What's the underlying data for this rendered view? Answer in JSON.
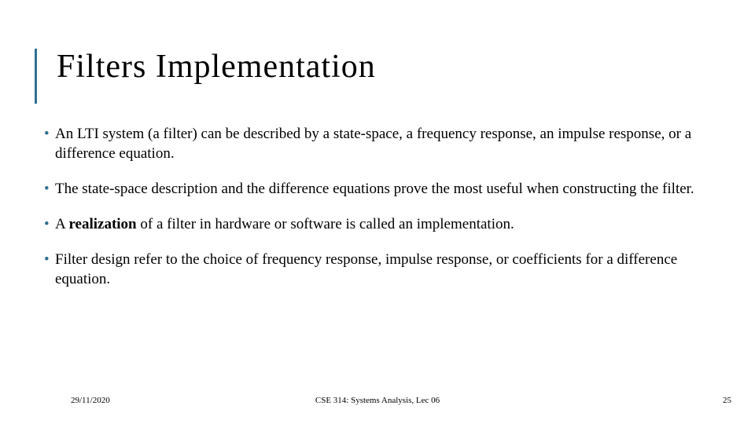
{
  "title": "Filters Implementation",
  "bullets": {
    "b0": "An LTI system (a filter) can be described by a state-space, a frequency response, an impulse response, or a difference equation.",
    "b1": "The state-space description and the difference equations prove the most useful when constructing the filter.",
    "b2_pre": "A ",
    "b2_bold": "realization",
    "b2_post": " of a filter in hardware or software is called an implementation.",
    "b3": "Filter design refer to the choice of frequency response, impulse response, or coefficients for a difference equation."
  },
  "footer": {
    "date": "29/11/2020",
    "course": "CSE 314: Systems Analysis, Lec 06",
    "page": "25"
  }
}
